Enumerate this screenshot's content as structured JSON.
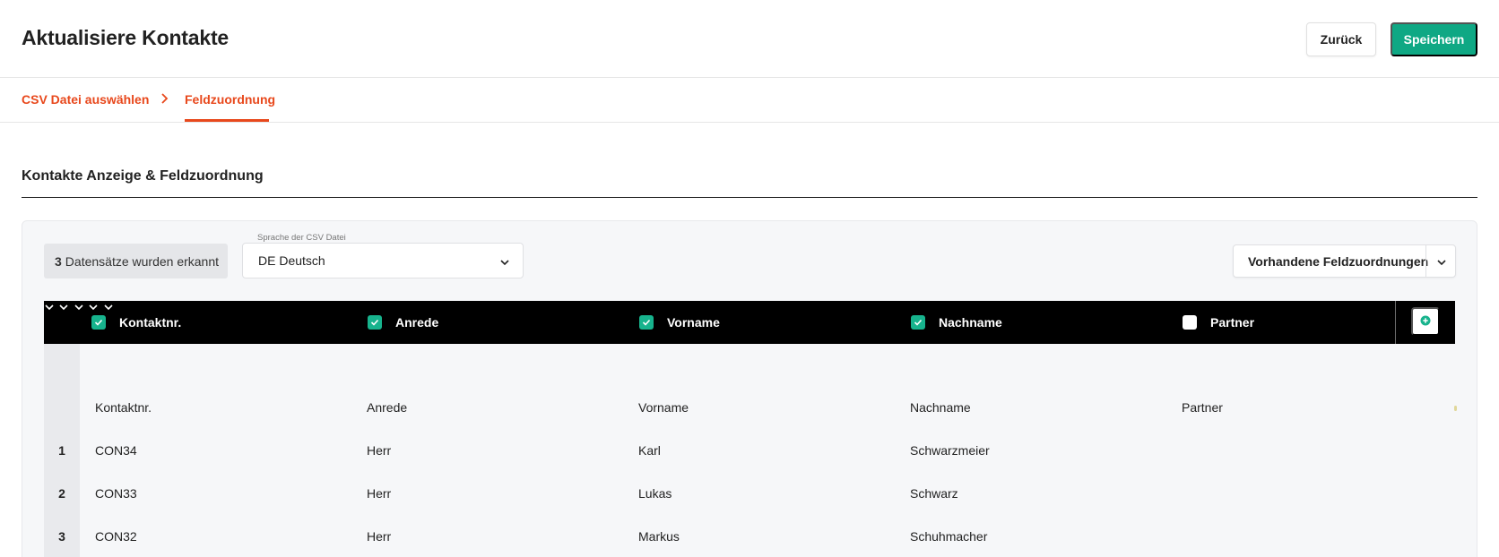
{
  "header": {
    "title": "Aktualisiere Kontakte",
    "back_label": "Zurück",
    "save_label": "Speichern",
    "accent": "#0fa884"
  },
  "stepper": {
    "steps": [
      {
        "label": "CSV Datei auswählen"
      },
      {
        "label": "Feldzuordnung",
        "active": true
      }
    ],
    "separator_icon": "chevron-right-icon",
    "accent": "#e8481c"
  },
  "section": {
    "title": "Kontakte Anzeige & Feldzuordnung"
  },
  "toolbar": {
    "records_count": "3",
    "records_text": "Datensätze wurden erkannt",
    "language_label": "Sprache der CSV Datei",
    "language_value": "DE Deutsch",
    "mappings_label": "Vorhandene Feldzuordnungen"
  },
  "table": {
    "columns": [
      {
        "label": "Kontaktnr.",
        "checked": true
      },
      {
        "label": "Anrede",
        "checked": true
      },
      {
        "label": "Vorname",
        "checked": true
      },
      {
        "label": "Nachname",
        "checked": true
      },
      {
        "label": "Partner",
        "checked": false
      }
    ],
    "source_headers": [
      "Kontaktnr.",
      "Anrede",
      "Vorname",
      "Nachname",
      "Partner"
    ],
    "rows": [
      {
        "num": "1",
        "cells": [
          "CON34",
          "Herr",
          "Karl",
          "Schwarzmeier",
          ""
        ]
      },
      {
        "num": "2",
        "cells": [
          "CON33",
          "Herr",
          "Lukas",
          "Schwarz",
          ""
        ]
      },
      {
        "num": "3",
        "cells": [
          "CON32",
          "Herr",
          "Markus",
          "Schuhmacher",
          ""
        ]
      }
    ],
    "checkbox_color": "#17b38d"
  }
}
